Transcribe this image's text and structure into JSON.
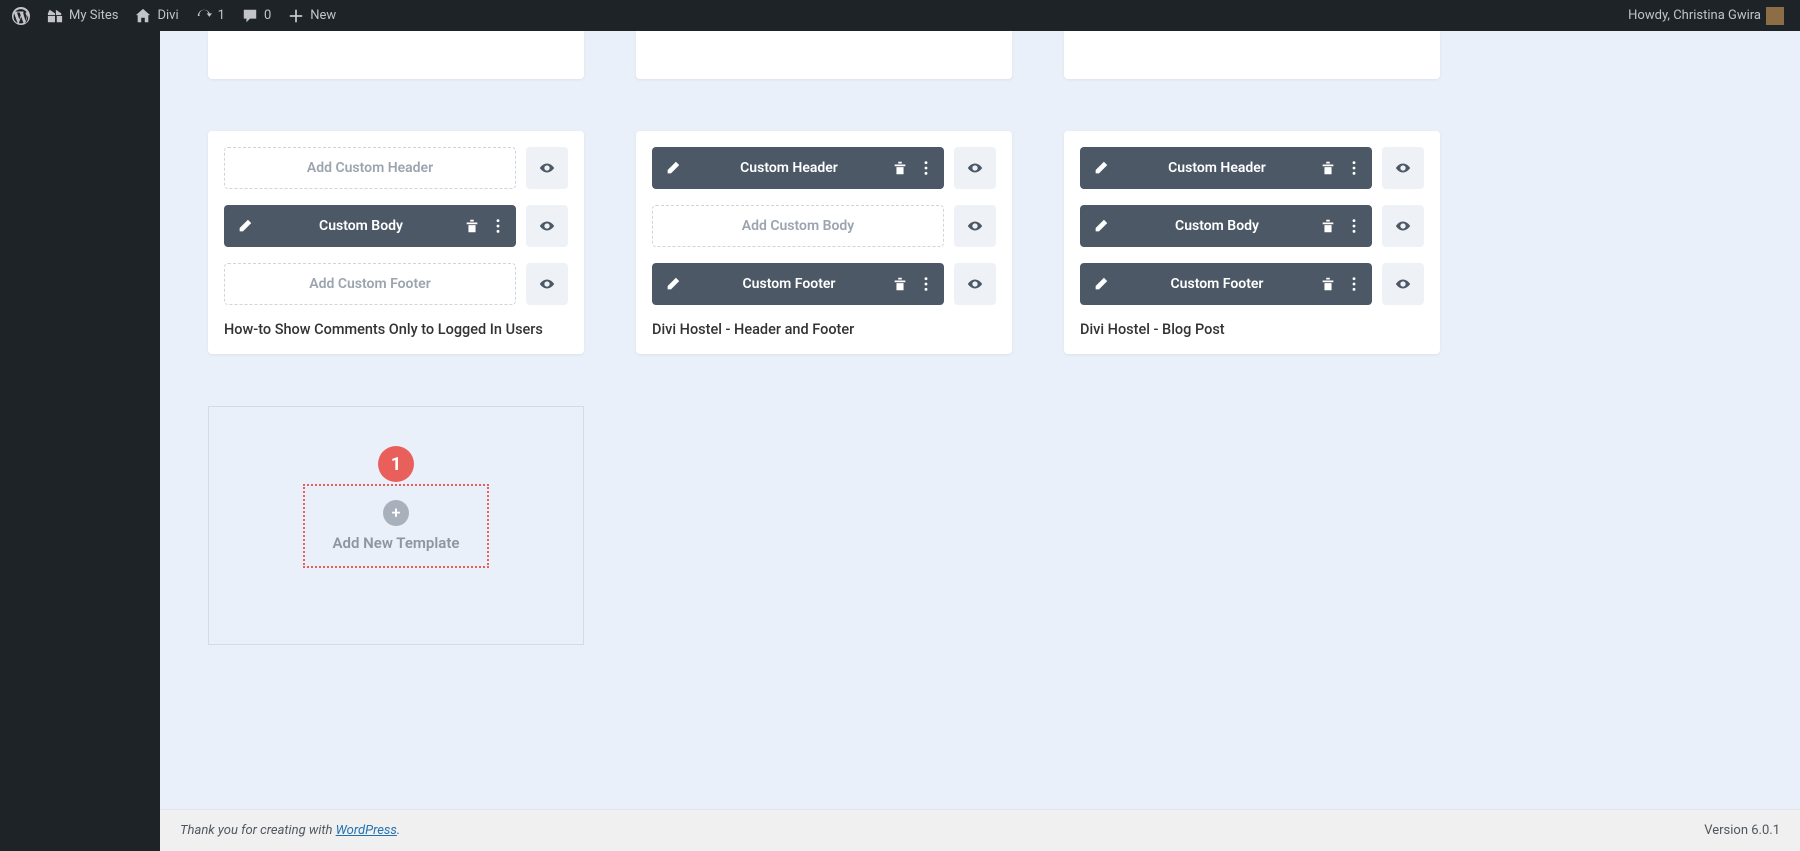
{
  "adminbar": {
    "mysites": "My Sites",
    "site": "Divi",
    "updates": "1",
    "comments": "0",
    "new": "New",
    "howdy": "Howdy, Christina Gwira"
  },
  "cards": {
    "c1": {
      "title": "How-to Show Comments Only to Logged In Users",
      "add_header": "Add Custom Header",
      "body": "Custom Body",
      "add_footer": "Add Custom Footer"
    },
    "c2": {
      "title": "Divi Hostel - Header and Footer",
      "header": "Custom Header",
      "add_body": "Add Custom Body",
      "footer": "Custom Footer"
    },
    "c3": {
      "title": "Divi Hostel - Blog Post",
      "header": "Custom Header",
      "body": "Custom Body",
      "footer": "Custom Footer"
    }
  },
  "add": {
    "label": "Add New Template",
    "badge": "1"
  },
  "footer": {
    "thanks_prefix": "Thank you for creating with ",
    "wp": "WordPress",
    "period": ".",
    "version": "Version 6.0.1"
  }
}
